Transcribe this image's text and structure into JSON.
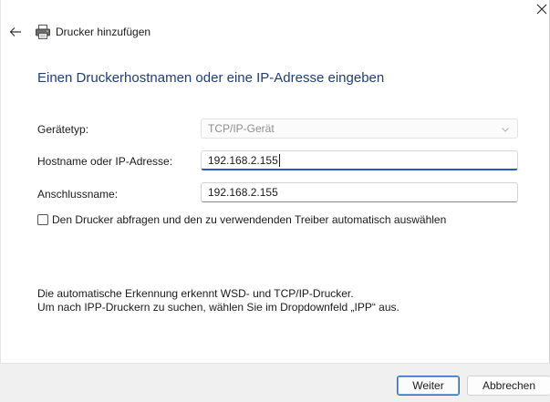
{
  "window": {
    "title": "Drucker hinzufügen",
    "back_icon": "arrow-left-icon",
    "app_icon": "printer-icon",
    "close_icon": "close-icon"
  },
  "page": {
    "heading": "Einen Druckerhostnamen oder eine IP-Adresse eingeben"
  },
  "form": {
    "device_type": {
      "label": "Gerätetyp:",
      "value": "TCP/IP-Gerät",
      "disabled": true
    },
    "hostname": {
      "label": "Hostname oder IP-Adresse:",
      "value": "192.168.2.155"
    },
    "port_name": {
      "label": "Anschlussname:",
      "value": "192.168.2.155"
    },
    "query_printer": {
      "label": "Den Drucker abfragen und den zu verwendenden Treiber automatisch auswählen",
      "checked": false
    }
  },
  "info": {
    "line1": "Die automatische Erkennung erkennt WSD- und TCP/IP-Drucker.",
    "line2": "Um nach IPP-Druckern zu suchen, wählen Sie im Dropdownfeld „IPP“ aus."
  },
  "buttons": {
    "next": "Weiter",
    "cancel": "Abbrechen"
  },
  "colors": {
    "heading": "#1f3d7a",
    "focus_accent": "#1c5fb5",
    "footer_bg": "#f0f0f0"
  }
}
